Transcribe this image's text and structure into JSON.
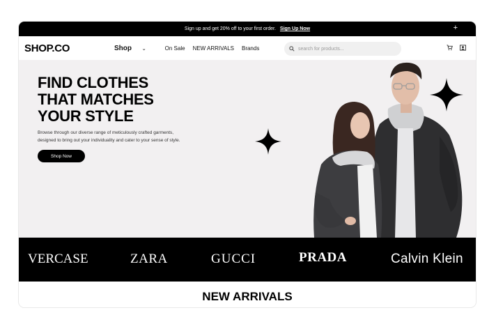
{
  "promo": {
    "text": "Sign up and get 20% off to your first order.",
    "cta": "Sign Up Now",
    "close_icon": "plus"
  },
  "header": {
    "logo": "SHOP.CO",
    "nav": [
      {
        "label": "Shop",
        "has_dropdown": true
      },
      {
        "label": "On Sale"
      },
      {
        "label": "NEW ARRIVALS"
      },
      {
        "label": "Brands"
      }
    ],
    "search_placeholder": "search for products...",
    "icons": [
      "cart-icon",
      "account-icon"
    ]
  },
  "hero": {
    "title_lines": [
      "FIND CLOTHES",
      "THAT MATCHES",
      "YOUR STYLE"
    ],
    "description_lines": [
      "Browse through our diverse range of meticulously crafted garments,",
      "designed to bring out your individuality and cater to your sense of style."
    ],
    "button": "Shop Now"
  },
  "brands": [
    "VERCASE",
    "ZARA",
    "GUCCI",
    "PRADA",
    "Calvin Klein"
  ],
  "section": {
    "title": "NEW ARRIVALS"
  },
  "colors": {
    "black": "#000000",
    "hero_bg": "#f2f0f1",
    "search_bg": "#f0f0f0"
  }
}
